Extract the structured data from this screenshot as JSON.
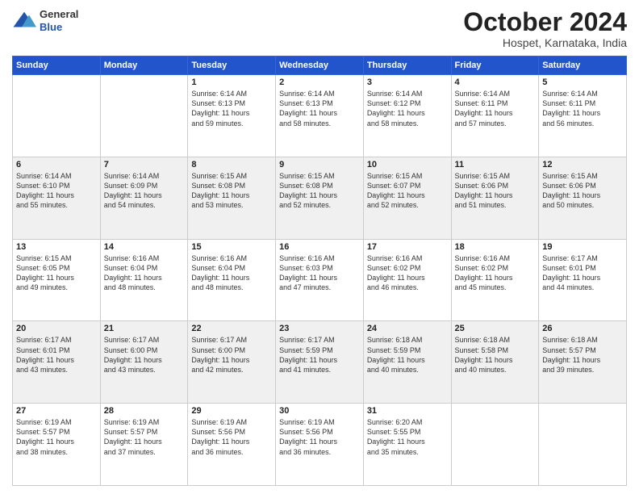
{
  "header": {
    "logo": {
      "general": "General",
      "blue": "Blue"
    },
    "title": "October 2024",
    "location": "Hospet, Karnataka, India"
  },
  "calendar": {
    "days_of_week": [
      "Sunday",
      "Monday",
      "Tuesday",
      "Wednesday",
      "Thursday",
      "Friday",
      "Saturday"
    ],
    "weeks": [
      [
        {
          "day": "",
          "lines": []
        },
        {
          "day": "",
          "lines": []
        },
        {
          "day": "1",
          "lines": [
            "Sunrise: 6:14 AM",
            "Sunset: 6:13 PM",
            "Daylight: 11 hours",
            "and 59 minutes."
          ]
        },
        {
          "day": "2",
          "lines": [
            "Sunrise: 6:14 AM",
            "Sunset: 6:13 PM",
            "Daylight: 11 hours",
            "and 58 minutes."
          ]
        },
        {
          "day": "3",
          "lines": [
            "Sunrise: 6:14 AM",
            "Sunset: 6:12 PM",
            "Daylight: 11 hours",
            "and 58 minutes."
          ]
        },
        {
          "day": "4",
          "lines": [
            "Sunrise: 6:14 AM",
            "Sunset: 6:11 PM",
            "Daylight: 11 hours",
            "and 57 minutes."
          ]
        },
        {
          "day": "5",
          "lines": [
            "Sunrise: 6:14 AM",
            "Sunset: 6:11 PM",
            "Daylight: 11 hours",
            "and 56 minutes."
          ]
        }
      ],
      [
        {
          "day": "6",
          "lines": [
            "Sunrise: 6:14 AM",
            "Sunset: 6:10 PM",
            "Daylight: 11 hours",
            "and 55 minutes."
          ]
        },
        {
          "day": "7",
          "lines": [
            "Sunrise: 6:14 AM",
            "Sunset: 6:09 PM",
            "Daylight: 11 hours",
            "and 54 minutes."
          ]
        },
        {
          "day": "8",
          "lines": [
            "Sunrise: 6:15 AM",
            "Sunset: 6:08 PM",
            "Daylight: 11 hours",
            "and 53 minutes."
          ]
        },
        {
          "day": "9",
          "lines": [
            "Sunrise: 6:15 AM",
            "Sunset: 6:08 PM",
            "Daylight: 11 hours",
            "and 52 minutes."
          ]
        },
        {
          "day": "10",
          "lines": [
            "Sunrise: 6:15 AM",
            "Sunset: 6:07 PM",
            "Daylight: 11 hours",
            "and 52 minutes."
          ]
        },
        {
          "day": "11",
          "lines": [
            "Sunrise: 6:15 AM",
            "Sunset: 6:06 PM",
            "Daylight: 11 hours",
            "and 51 minutes."
          ]
        },
        {
          "day": "12",
          "lines": [
            "Sunrise: 6:15 AM",
            "Sunset: 6:06 PM",
            "Daylight: 11 hours",
            "and 50 minutes."
          ]
        }
      ],
      [
        {
          "day": "13",
          "lines": [
            "Sunrise: 6:15 AM",
            "Sunset: 6:05 PM",
            "Daylight: 11 hours",
            "and 49 minutes."
          ]
        },
        {
          "day": "14",
          "lines": [
            "Sunrise: 6:16 AM",
            "Sunset: 6:04 PM",
            "Daylight: 11 hours",
            "and 48 minutes."
          ]
        },
        {
          "day": "15",
          "lines": [
            "Sunrise: 6:16 AM",
            "Sunset: 6:04 PM",
            "Daylight: 11 hours",
            "and 48 minutes."
          ]
        },
        {
          "day": "16",
          "lines": [
            "Sunrise: 6:16 AM",
            "Sunset: 6:03 PM",
            "Daylight: 11 hours",
            "and 47 minutes."
          ]
        },
        {
          "day": "17",
          "lines": [
            "Sunrise: 6:16 AM",
            "Sunset: 6:02 PM",
            "Daylight: 11 hours",
            "and 46 minutes."
          ]
        },
        {
          "day": "18",
          "lines": [
            "Sunrise: 6:16 AM",
            "Sunset: 6:02 PM",
            "Daylight: 11 hours",
            "and 45 minutes."
          ]
        },
        {
          "day": "19",
          "lines": [
            "Sunrise: 6:17 AM",
            "Sunset: 6:01 PM",
            "Daylight: 11 hours",
            "and 44 minutes."
          ]
        }
      ],
      [
        {
          "day": "20",
          "lines": [
            "Sunrise: 6:17 AM",
            "Sunset: 6:01 PM",
            "Daylight: 11 hours",
            "and 43 minutes."
          ]
        },
        {
          "day": "21",
          "lines": [
            "Sunrise: 6:17 AM",
            "Sunset: 6:00 PM",
            "Daylight: 11 hours",
            "and 43 minutes."
          ]
        },
        {
          "day": "22",
          "lines": [
            "Sunrise: 6:17 AM",
            "Sunset: 6:00 PM",
            "Daylight: 11 hours",
            "and 42 minutes."
          ]
        },
        {
          "day": "23",
          "lines": [
            "Sunrise: 6:17 AM",
            "Sunset: 5:59 PM",
            "Daylight: 11 hours",
            "and 41 minutes."
          ]
        },
        {
          "day": "24",
          "lines": [
            "Sunrise: 6:18 AM",
            "Sunset: 5:59 PM",
            "Daylight: 11 hours",
            "and 40 minutes."
          ]
        },
        {
          "day": "25",
          "lines": [
            "Sunrise: 6:18 AM",
            "Sunset: 5:58 PM",
            "Daylight: 11 hours",
            "and 40 minutes."
          ]
        },
        {
          "day": "26",
          "lines": [
            "Sunrise: 6:18 AM",
            "Sunset: 5:57 PM",
            "Daylight: 11 hours",
            "and 39 minutes."
          ]
        }
      ],
      [
        {
          "day": "27",
          "lines": [
            "Sunrise: 6:19 AM",
            "Sunset: 5:57 PM",
            "Daylight: 11 hours",
            "and 38 minutes."
          ]
        },
        {
          "day": "28",
          "lines": [
            "Sunrise: 6:19 AM",
            "Sunset: 5:57 PM",
            "Daylight: 11 hours",
            "and 37 minutes."
          ]
        },
        {
          "day": "29",
          "lines": [
            "Sunrise: 6:19 AM",
            "Sunset: 5:56 PM",
            "Daylight: 11 hours",
            "and 36 minutes."
          ]
        },
        {
          "day": "30",
          "lines": [
            "Sunrise: 6:19 AM",
            "Sunset: 5:56 PM",
            "Daylight: 11 hours",
            "and 36 minutes."
          ]
        },
        {
          "day": "31",
          "lines": [
            "Sunrise: 6:20 AM",
            "Sunset: 5:55 PM",
            "Daylight: 11 hours",
            "and 35 minutes."
          ]
        },
        {
          "day": "",
          "lines": []
        },
        {
          "day": "",
          "lines": []
        }
      ]
    ]
  }
}
